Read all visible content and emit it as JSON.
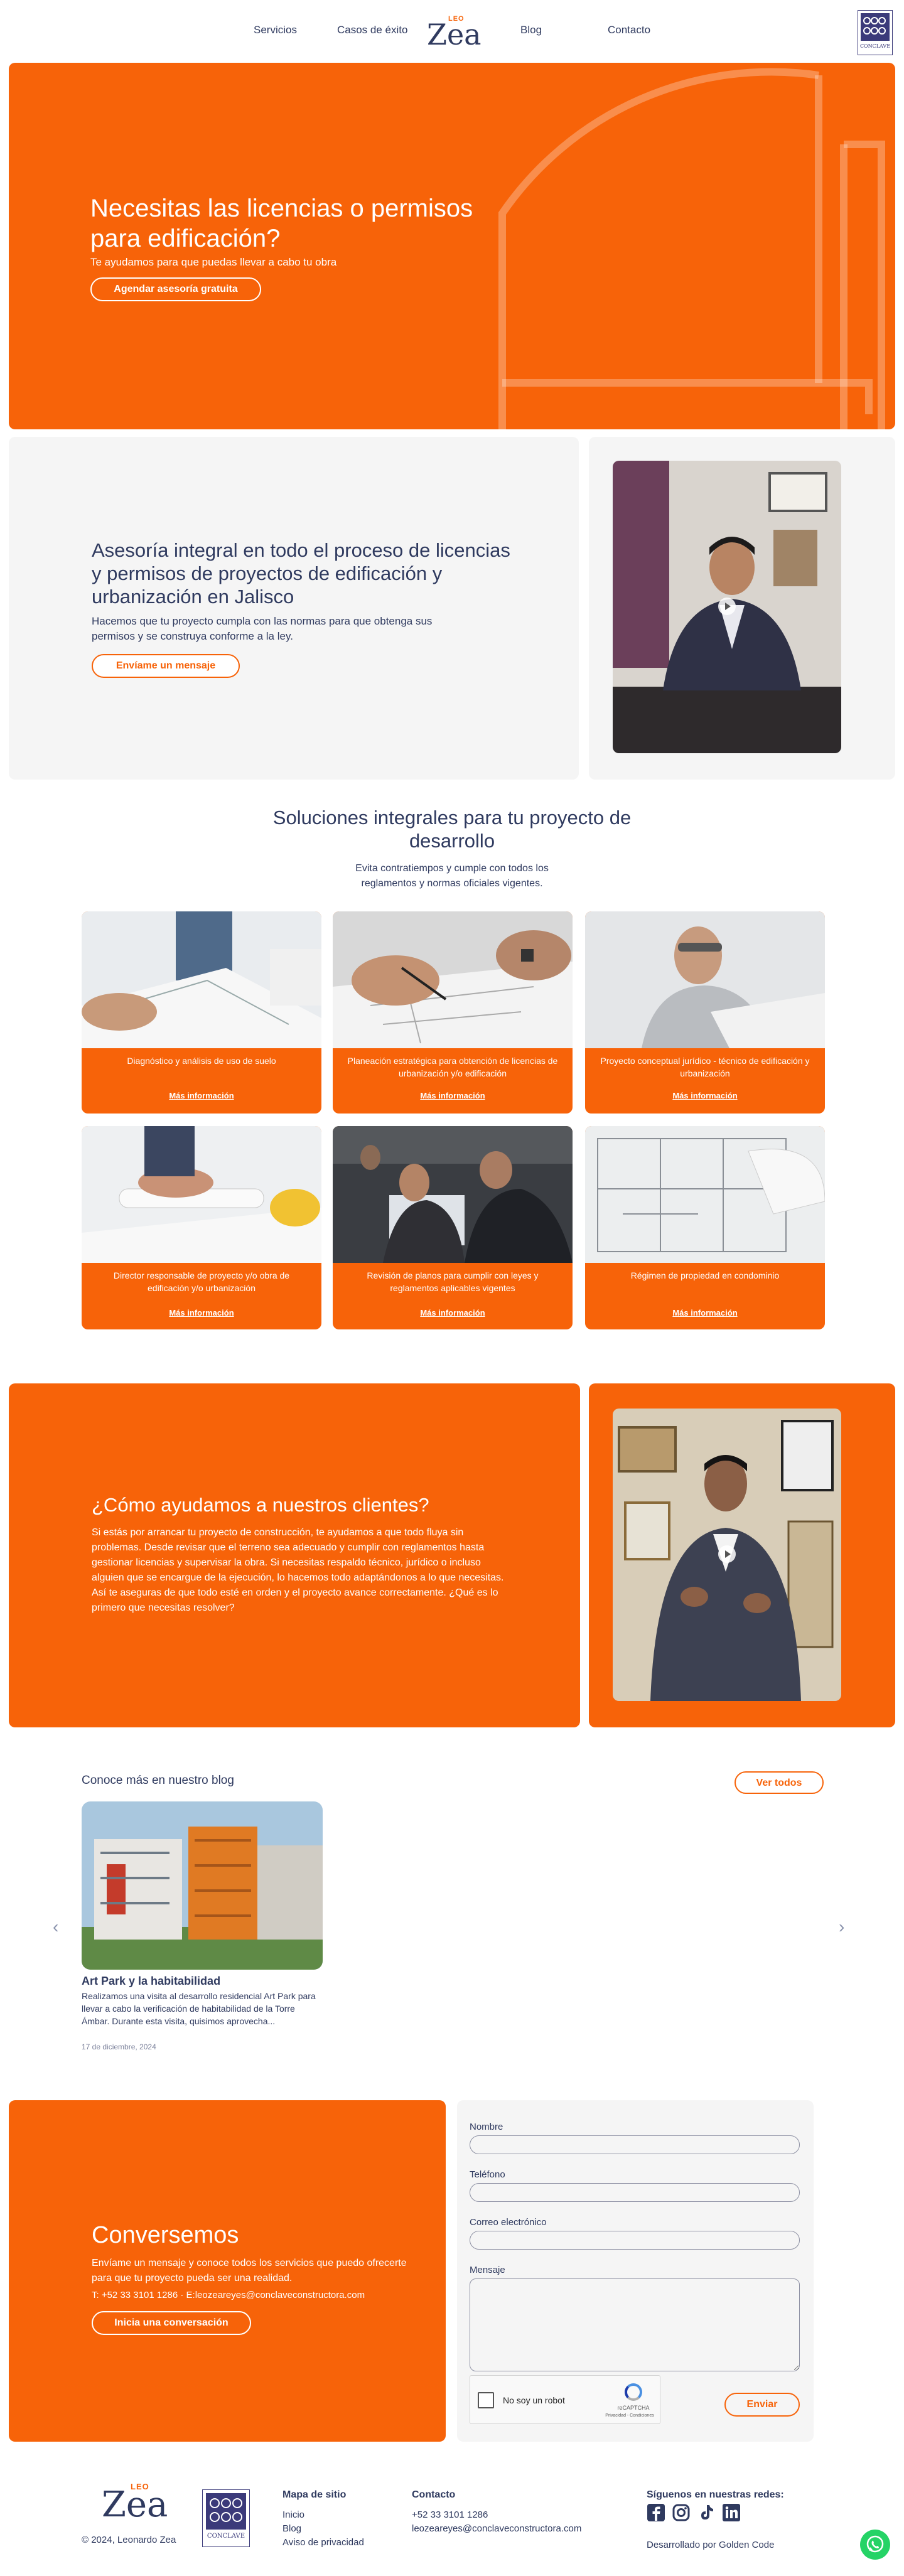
{
  "nav": {
    "items": [
      "Servicios",
      "Casos de éxito",
      "Blog",
      "Contacto"
    ],
    "logo_leo": "LEO",
    "logo_zea": "Zea",
    "conclave_text": "CONCLAVE"
  },
  "hero": {
    "title": "Necesitas las licencias o permisos para edificación?",
    "subtitle": "Te ayudamos para que puedas llevar a cabo tu obra",
    "button": "Agendar asesoría gratuita"
  },
  "asesoria": {
    "title": "Asesoría integral en todo el proceso de licencias y permisos de proyectos de edificación y urbanización en Jalisco",
    "text": "Hacemos que tu proyecto cumpla con las normas para que obtenga sus permisos y se construya conforme a la ley.",
    "button": "Envíame un mensaje"
  },
  "soluciones": {
    "title": "Soluciones integrales para tu proyecto de desarrollo",
    "subtitle": "Evita contratiempos y cumple con todos los reglamentos y normas oficiales vigentes.",
    "more_label": "Más información",
    "cards": [
      {
        "title": "Diagnóstico y análisis de uso de suelo"
      },
      {
        "title": "Planeación estratégica para obtención de licencias de urbanización y/o edificación"
      },
      {
        "title": "Proyecto conceptual jurídico - técnico de edificación y urbanización"
      },
      {
        "title": "Director responsable de proyecto y/o obra de edificación y/o urbanización"
      },
      {
        "title": "Revisión de planos para cumplir con leyes y reglamentos aplicables vigentes"
      },
      {
        "title": "Régimen de propiedad en condominio"
      }
    ]
  },
  "como": {
    "title": "¿Cómo ayudamos a nuestros clientes?",
    "text": "Si estás por arrancar tu proyecto de construcción, te ayudamos a que todo fluya sin problemas. Desde revisar que el terreno sea adecuado y cumplir con reglamentos hasta gestionar licencias y supervisar la obra. Si necesitas respaldo técnico, jurídico o incluso alguien que se encargue de la ejecución, lo hacemos todo adaptándonos a lo que necesitas. Así te aseguras de que todo esté en orden y el proyecto avance correctamente. ¿Qué es lo primero que necesitas resolver?"
  },
  "blog": {
    "heading": "Conoce más en nuestro blog",
    "all_button": "Ver todos",
    "post": {
      "title": "Art Park y la habitabilidad",
      "excerpt": "Realizamos una visita al desarrollo residencial Art Park para llevar a cabo la verificación de habitabilidad de la Torre Ámbar. Durante esta visita, quisimos aprovecha...",
      "date": "17 de diciembre, 2024"
    },
    "prev": "‹",
    "next": "›"
  },
  "conversemos": {
    "title": "Conversemos",
    "text": "Envíame un mensaje y conoce todos los servicios que puedo ofrecerte para que tu proyecto pueda ser una realidad.",
    "contact": "T: +52 33 3101 1286 · E:leozeareyes@conclaveconstructora.com",
    "button": "Inicia una conversación"
  },
  "form": {
    "name_label": "Nombre",
    "phone_label": "Teléfono",
    "email_label": "Correo electrónico",
    "message_label": "Mensaje",
    "captcha_label": "No soy un robot",
    "captcha_brand": "reCAPTCHA",
    "captcha_sub": "Privacidad - Condiciones",
    "submit": "Enviar"
  },
  "footer": {
    "copyright": "© 2024, Leonardo Zea",
    "map_title": "Mapa de sitio",
    "map_items": [
      "Inicio",
      "Blog",
      "Aviso de privacidad"
    ],
    "contact_title": "Contacto",
    "phone": "+52 33 3101 1286",
    "email": "leozeareyes@conclaveconstructora.com",
    "social_title": "Síguenos en nuestras redes:",
    "developer": "Desarrollado por Golden Code"
  },
  "colors": {
    "accent": "#f76309",
    "text": "#2f3a5f",
    "panel": "#f5f5f5"
  }
}
